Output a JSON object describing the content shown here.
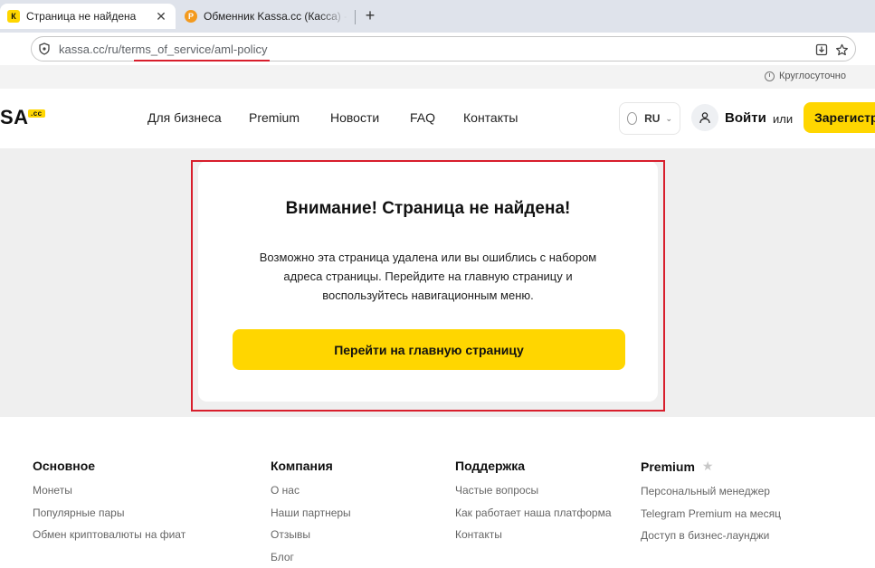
{
  "browser": {
    "tabs": [
      {
        "title": "Страница не найдена",
        "favicon": "К",
        "active": true
      },
      {
        "title": "Обменник Kassa.cc (Касса) - об",
        "favicon": "P",
        "active": false
      }
    ],
    "new_tab_symbol": "+",
    "url": {
      "host": "kassa.cc/ru/",
      "path": "terms_of_service/aml-policy"
    }
  },
  "site": {
    "hours": "Круглосуточно",
    "logo": {
      "text": "SA",
      "badge": ".cc"
    },
    "nav": [
      "Для бизнеса",
      "Premium",
      "Новости",
      "FAQ",
      "Контакты"
    ],
    "language": "RU",
    "login": "Войти",
    "or": "или",
    "register": "Зарегистр"
  },
  "error_card": {
    "title": "Внимание! Страница не найдена!",
    "description_lines": [
      "Возможно эта страница удалена или вы ошиблись с набором",
      "адреса страницы. Перейдите на главную страницу и",
      "воспользуйтесь навигационным меню."
    ],
    "button": "Перейти на главную страницу"
  },
  "footer": {
    "columns": [
      {
        "title": "Основное",
        "items": [
          "Монеты",
          "Популярные пары",
          "Обмен криптовалюты на фиат"
        ]
      },
      {
        "title": "Компания",
        "items": [
          "О нас",
          "Наши партнеры",
          "Отзывы",
          "Блог"
        ]
      },
      {
        "title": "Поддержка",
        "items": [
          "Частые вопросы",
          "Как работает наша платформа",
          "Контакты"
        ]
      },
      {
        "title": "Premium",
        "items": [
          "Персональный менеджер",
          "Telegram Premium на месяц",
          "Доступ в бизнес-лаунджи"
        ]
      }
    ]
  },
  "colors": {
    "accent_yellow": "#ffd600",
    "highlight_red": "#d81e2c",
    "page_grey": "#efefef"
  }
}
